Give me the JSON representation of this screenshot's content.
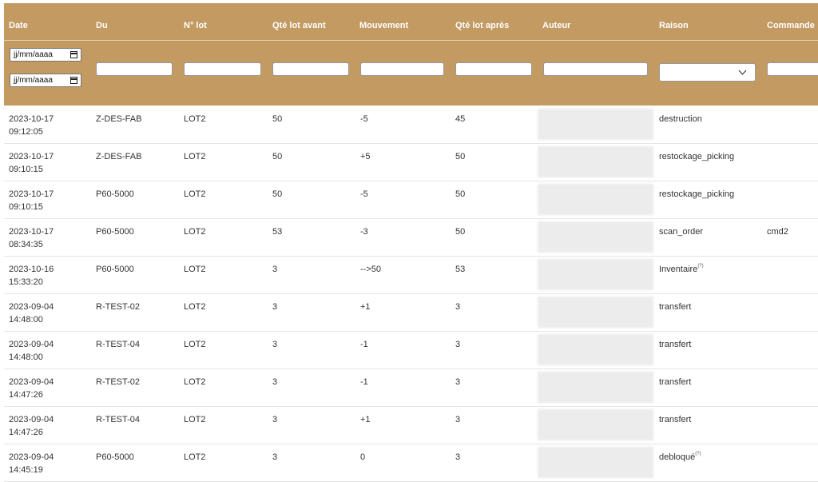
{
  "headers": [
    "Date",
    "Du",
    "N° lot",
    "Qté lot avant",
    "Mouvement",
    "Qté lot après",
    "Auteur",
    "Raison",
    "Commande"
  ],
  "filters": {
    "date_from_placeholder": "jj/mm/aaaa",
    "date_to_placeholder": "jj/mm/aaaa"
  },
  "rows": [
    {
      "date": "2023-10-17",
      "time": "09:12:05",
      "du": "Z-DES-FAB",
      "lot": "LOT2",
      "avant": "50",
      "mouvement": "-5",
      "apres": "45",
      "raison": "destruction",
      "raison_sup": "",
      "commande": ""
    },
    {
      "date": "2023-10-17",
      "time": "09:10:15",
      "du": "Z-DES-FAB",
      "lot": "LOT2",
      "avant": "50",
      "mouvement": "+5",
      "apres": "50",
      "raison": "restockage_picking",
      "raison_sup": "",
      "commande": ""
    },
    {
      "date": "2023-10-17",
      "time": "09:10:15",
      "du": "P60-5000",
      "lot": "LOT2",
      "avant": "50",
      "mouvement": "-5",
      "apres": "50",
      "raison": "restockage_picking",
      "raison_sup": "",
      "commande": ""
    },
    {
      "date": "2023-10-17",
      "time": "08:34:35",
      "du": "P60-5000",
      "lot": "LOT2",
      "avant": "53",
      "mouvement": "-3",
      "apres": "50",
      "raison": "scan_order",
      "raison_sup": "",
      "commande": "cmd2"
    },
    {
      "date": "2023-10-16",
      "time": "15:33:20",
      "du": "P60-5000",
      "lot": "LOT2",
      "avant": "3",
      "mouvement": "-->50",
      "apres": "53",
      "raison": "Inventaire",
      "raison_sup": "(?)",
      "commande": ""
    },
    {
      "date": "2023-09-04",
      "time": "14:48:00",
      "du": "R-TEST-02",
      "lot": "LOT2",
      "avant": "3",
      "mouvement": "+1",
      "apres": "3",
      "raison": "transfert",
      "raison_sup": "",
      "commande": ""
    },
    {
      "date": "2023-09-04",
      "time": "14:48:00",
      "du": "R-TEST-04",
      "lot": "LOT2",
      "avant": "3",
      "mouvement": "-1",
      "apres": "3",
      "raison": "transfert",
      "raison_sup": "",
      "commande": ""
    },
    {
      "date": "2023-09-04",
      "time": "14:47:26",
      "du": "R-TEST-02",
      "lot": "LOT2",
      "avant": "3",
      "mouvement": "-1",
      "apres": "3",
      "raison": "transfert",
      "raison_sup": "",
      "commande": ""
    },
    {
      "date": "2023-09-04",
      "time": "14:47:26",
      "du": "R-TEST-04",
      "lot": "LOT2",
      "avant": "3",
      "mouvement": "+1",
      "apres": "3",
      "raison": "transfert",
      "raison_sup": "",
      "commande": ""
    },
    {
      "date": "2023-09-04",
      "time": "14:45:19",
      "du": "P60-5000",
      "lot": "LOT2",
      "avant": "3",
      "mouvement": "0",
      "apres": "3",
      "raison": "debloqué",
      "raison_sup": "(?)",
      "commande": ""
    }
  ],
  "colors": {
    "header_bg": "#c29a62",
    "header_text": "#ffffff"
  }
}
